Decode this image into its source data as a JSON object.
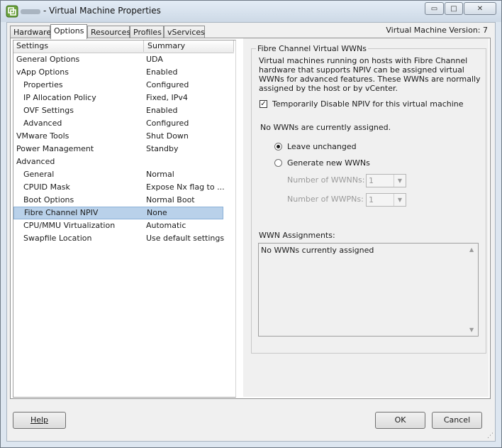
{
  "window": {
    "title": "- Virtual Machine Properties",
    "controls": {
      "minimize": "▭",
      "maximize": "□",
      "close": "✕"
    }
  },
  "tabs": [
    "Hardware",
    "Options",
    "Resources",
    "Profiles",
    "vServices"
  ],
  "active_tab": "Options",
  "version_text": "Virtual Machine Version: 7",
  "list": {
    "headers": {
      "settings": "Settings",
      "summary": "Summary"
    },
    "rows": [
      {
        "setting": "General Options",
        "summary": "UDA",
        "indent": 0
      },
      {
        "setting": "vApp Options",
        "summary": "Enabled",
        "indent": 0
      },
      {
        "setting": "Properties",
        "summary": "Configured",
        "indent": 1
      },
      {
        "setting": "IP Allocation Policy",
        "summary": "Fixed, IPv4",
        "indent": 1
      },
      {
        "setting": "OVF Settings",
        "summary": "Enabled",
        "indent": 1
      },
      {
        "setting": "Advanced",
        "summary": "Configured",
        "indent": 1
      },
      {
        "setting": "VMware Tools",
        "summary": "Shut Down",
        "indent": 0
      },
      {
        "setting": "Power Management",
        "summary": "Standby",
        "indent": 0
      },
      {
        "setting": "Advanced",
        "summary": "",
        "indent": 0
      },
      {
        "setting": "General",
        "summary": "Normal",
        "indent": 1
      },
      {
        "setting": "CPUID Mask",
        "summary": "Expose Nx flag to ...",
        "indent": 1
      },
      {
        "setting": "Boot Options",
        "summary": "Normal Boot",
        "indent": 1
      },
      {
        "setting": "Fibre Channel NPIV",
        "summary": "None",
        "indent": 1,
        "selected": true
      },
      {
        "setting": "CPU/MMU Virtualization",
        "summary": "Automatic",
        "indent": 1
      },
      {
        "setting": "Swapfile Location",
        "summary": "Use default settings",
        "indent": 1
      }
    ]
  },
  "fc": {
    "group_label": "Fibre Channel Virtual WWNs",
    "description": "Virtual machines running on hosts with Fibre Channel hardware that supports NPIV can be assigned virtual WWNs for advanced features. These WWNs are normally assigned by the host or by vCenter.",
    "disable_npiv_label": "Temporarily Disable NPIV for this virtual machine",
    "disable_npiv_checked": true,
    "status": "No WWNs are currently assigned.",
    "radio_leave": "Leave unchanged",
    "radio_generate": "Generate new WWNs",
    "radio_selected": "leave",
    "wwnn_label": "Number of WWNNs:",
    "wwnn_value": "1",
    "wwpn_label": "Number of WWPNs:",
    "wwpn_value": "1",
    "assignments_label": "WWN Assignments:",
    "assignments_text": "No WWNs currently assigned"
  },
  "buttons": {
    "help": "Help",
    "ok": "OK",
    "cancel": "Cancel"
  }
}
